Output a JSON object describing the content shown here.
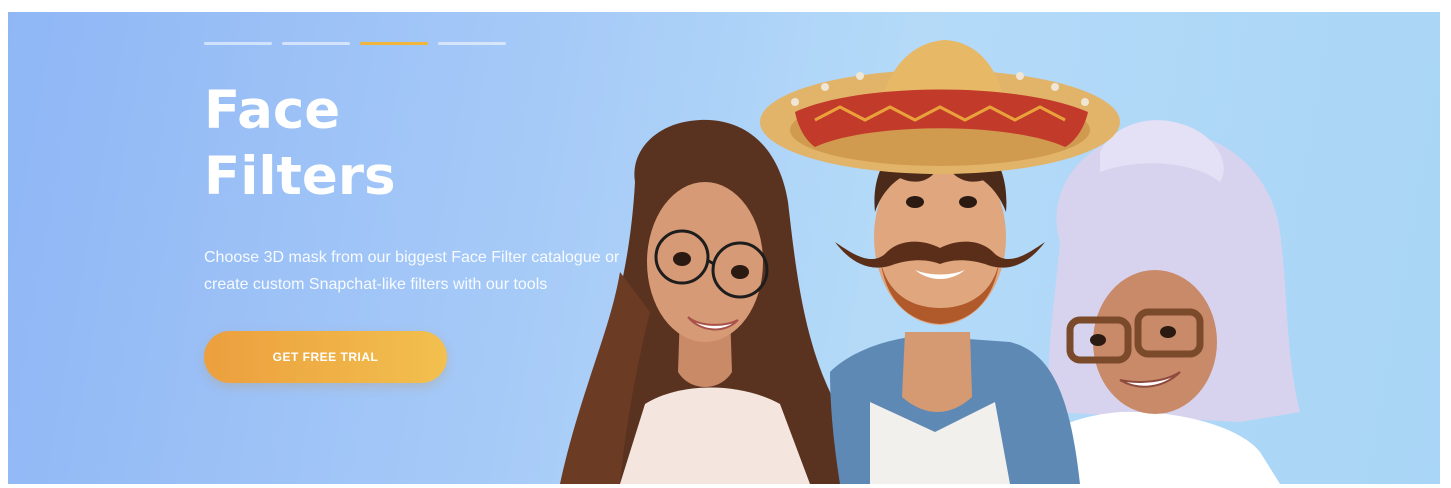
{
  "slider": {
    "dots": [
      {
        "label": "",
        "active": false
      },
      {
        "label": "",
        "active": false
      },
      {
        "label": "",
        "active": true
      },
      {
        "label": "",
        "active": false
      }
    ]
  },
  "hero": {
    "title": "Face\nFilters",
    "subtitle": "Choose 3D mask from our biggest Face Filter catalogue or create custom Snapchat-like filters with our tools",
    "cta_label": "GET FREE TRIAL"
  },
  "colors": {
    "accent": "#f0b53b",
    "cta_start": "#ec9f3e",
    "cta_end": "#f2c04e",
    "background": "#a9ccf6"
  },
  "illustration": {
    "people": [
      "girl-with-round-glasses",
      "man-with-sombrero-and-mustache",
      "woman-with-big-white-hair-and-glasses"
    ]
  }
}
